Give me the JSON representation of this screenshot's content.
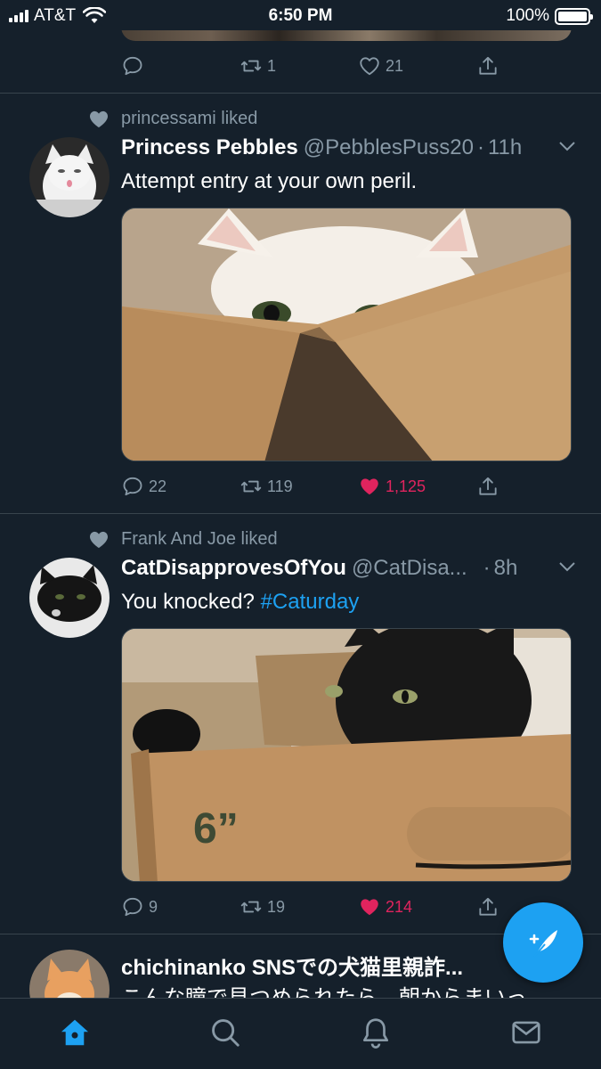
{
  "status_bar": {
    "carrier": "AT&T",
    "time": "6:50 PM",
    "battery": "100%",
    "battery_level": 1.0
  },
  "top_tweet": {
    "reply_count": "",
    "retweet_count": "1",
    "like_count": "21"
  },
  "tweets": [
    {
      "social_context": "princessami liked",
      "name": "Princess Pebbles",
      "handle": "@PebblesPuss20",
      "time": "11h",
      "text": "Attempt entry at your own peril.",
      "replies": "22",
      "retweets": "119",
      "likes": "1,125",
      "liked": true
    },
    {
      "social_context": "Frank And Joe liked",
      "name": "CatDisapprovesOfYou",
      "handle": "@CatDisa...",
      "time": "8h",
      "text": "You knocked?",
      "hashtag": "#Caturday",
      "replies": "9",
      "retweets": "19",
      "likes": "214",
      "liked": true,
      "box_label": "6”"
    },
    {
      "name": "chichinanko SNSでの犬猫里親詐...",
      "text": "こんな瞳で見つめられたら、朝からまいっ"
    }
  ],
  "nav": [
    "home-icon",
    "search-icon",
    "notifications-icon",
    "messages-icon"
  ],
  "colors": {
    "background": "#15202b",
    "accent": "#1da1f2",
    "like": "#e0245e",
    "muted": "#8899a6",
    "divider": "#38444d"
  }
}
